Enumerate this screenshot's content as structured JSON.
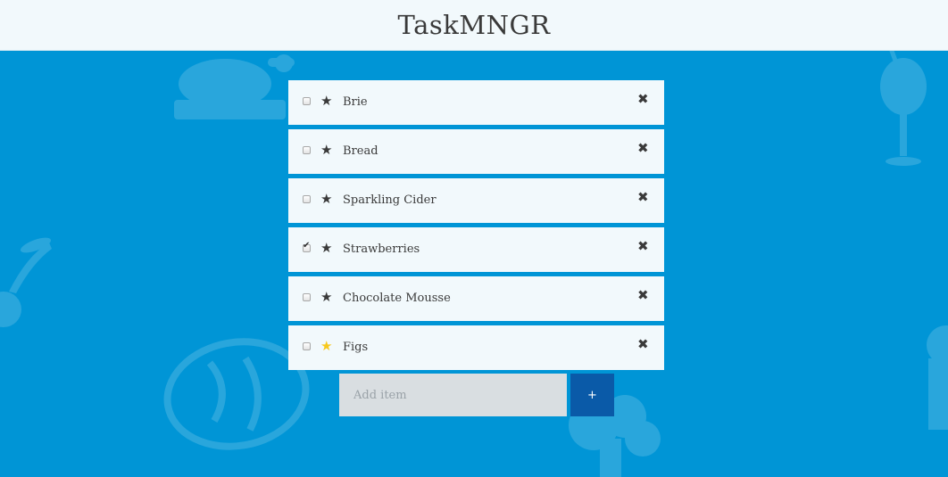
{
  "app": {
    "title": "TaskMNGR"
  },
  "items": [
    {
      "label": "Brie",
      "checked": false,
      "starred": false
    },
    {
      "label": "Bread",
      "checked": false,
      "starred": false
    },
    {
      "label": "Sparkling Cider",
      "checked": false,
      "starred": false
    },
    {
      "label": "Strawberries",
      "checked": true,
      "starred": false
    },
    {
      "label": "Chocolate Mousse",
      "checked": false,
      "starred": false
    },
    {
      "label": "Figs",
      "checked": false,
      "starred": true
    }
  ],
  "icons": {
    "star": "★",
    "delete": "✖",
    "check": "✔"
  },
  "add_form": {
    "placeholder": "Add item",
    "value": "",
    "button_label": "+"
  },
  "colors": {
    "background": "#0095d6",
    "header": "#f2f9fc",
    "item_background": "#f2f9fc",
    "text": "#3a3a3a",
    "star_active": "#f7c81c",
    "add_button": "#0a5aa8",
    "input_background": "#d9dee1"
  }
}
